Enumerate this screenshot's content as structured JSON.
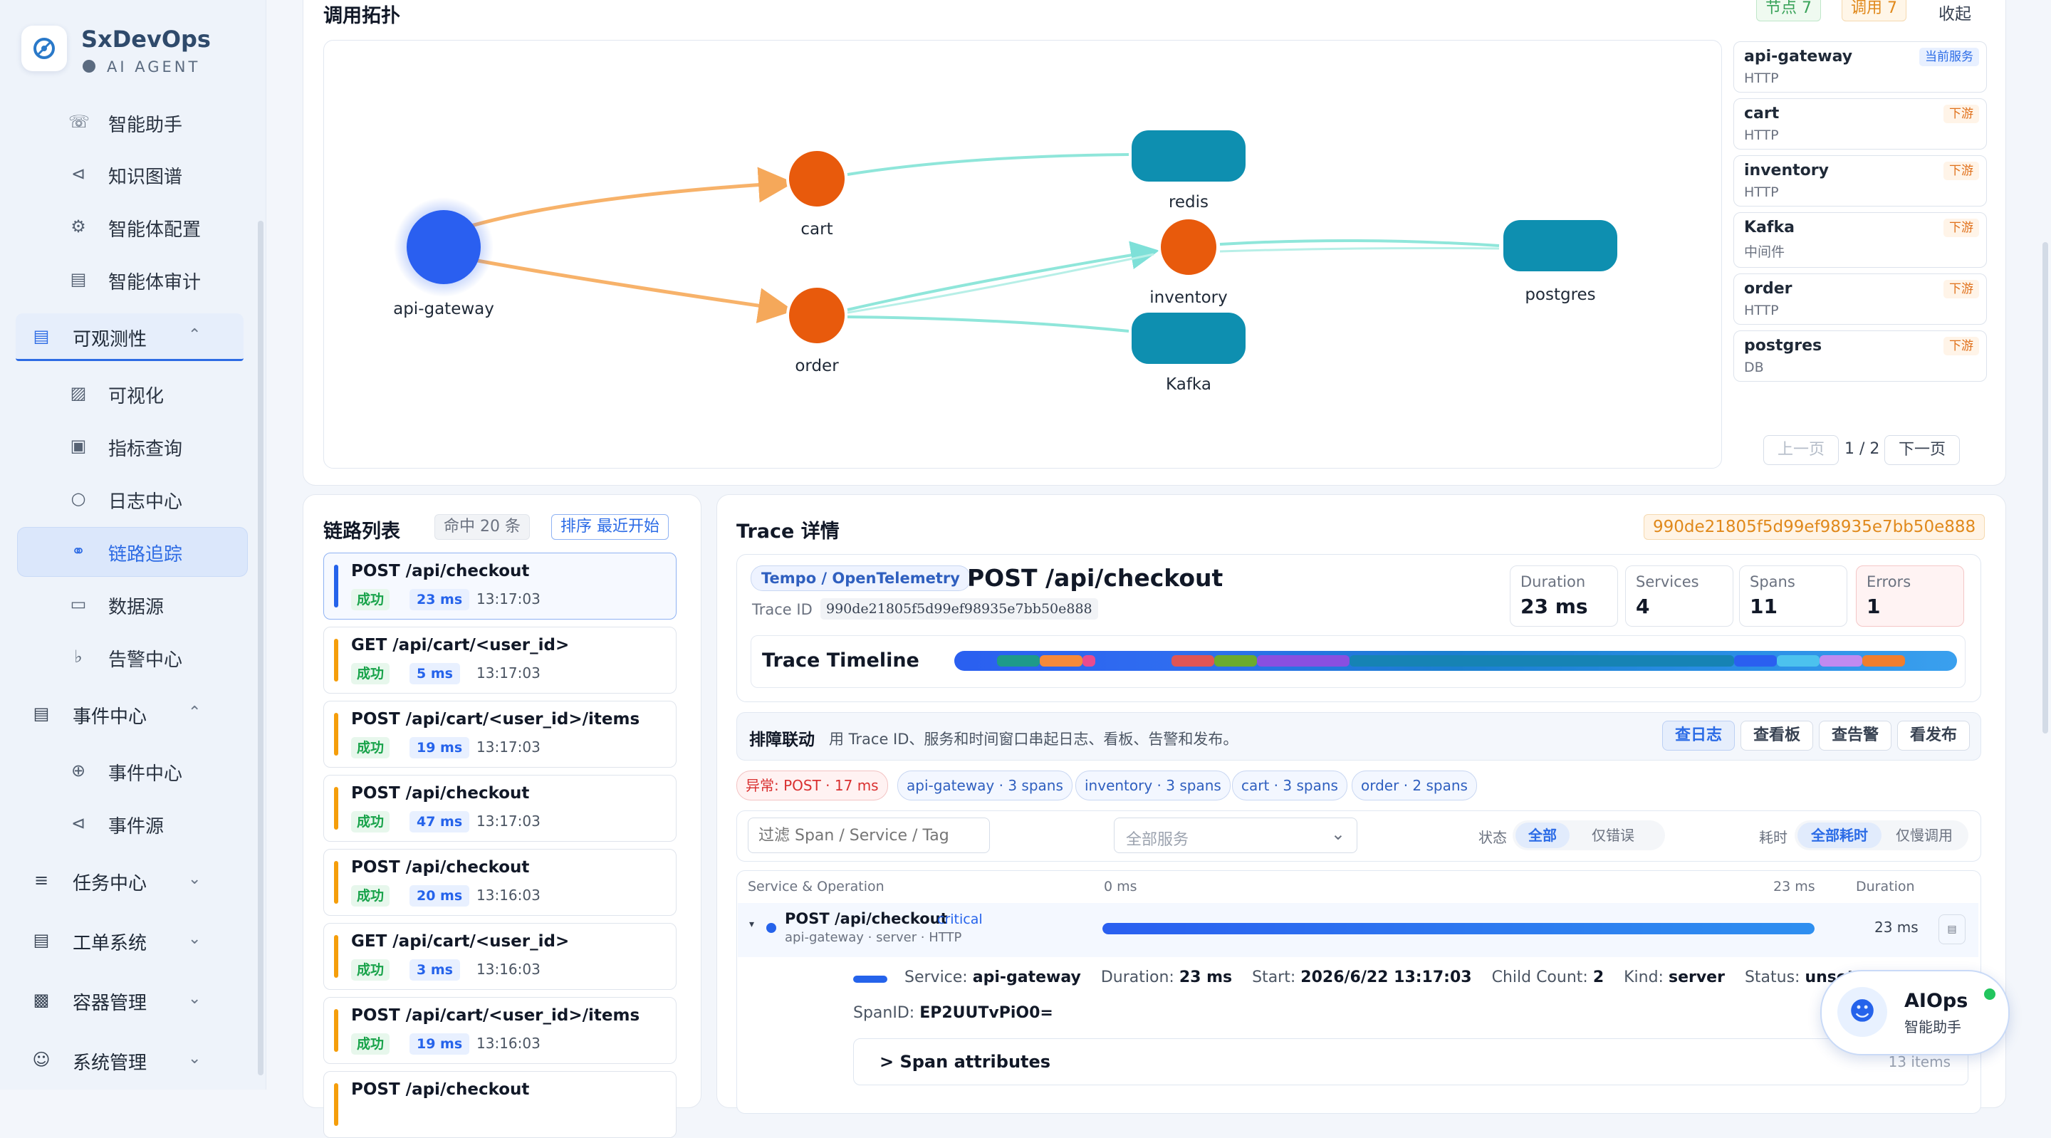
{
  "brand": {
    "title": "SxDevOps",
    "subtitle": "AI AGENT"
  },
  "sidebar": {
    "sub1": [
      {
        "label": "智能助手",
        "icon": "headset-icon"
      },
      {
        "label": "知识图谱",
        "icon": "share-icon"
      },
      {
        "label": "智能体配置",
        "icon": "gear-icon"
      },
      {
        "label": "智能体审计",
        "icon": "document-icon"
      }
    ],
    "group_observability": "可观测性",
    "sub2": [
      {
        "label": "可视化",
        "icon": "chart-icon"
      },
      {
        "label": "指标查询",
        "icon": "monitor-icon"
      },
      {
        "label": "日志中心",
        "icon": "search-icon"
      },
      {
        "label": "链路追踪",
        "icon": "trace-icon"
      },
      {
        "label": "数据源",
        "icon": "screen-icon"
      },
      {
        "label": "告警中心",
        "icon": "bell-icon"
      }
    ],
    "group_events": "事件中心",
    "sub3": [
      {
        "label": "事件中心",
        "icon": "crosshair-icon"
      },
      {
        "label": "事件源",
        "icon": "share-icon"
      }
    ],
    "groups": [
      {
        "label": "任务中心",
        "icon": "sliders-icon"
      },
      {
        "label": "工单系统",
        "icon": "document-icon"
      },
      {
        "label": "容器管理",
        "icon": "box-icon"
      },
      {
        "label": "系统管理",
        "icon": "user-icon"
      }
    ]
  },
  "topology": {
    "title": "调用拓扑",
    "node_chip": "节点 7",
    "call_chip": "调用 7",
    "collapse": "收起",
    "nodes": {
      "api_gateway": "api-gateway",
      "cart": "cart",
      "order": "order",
      "redis": "redis",
      "inventory": "inventory",
      "kafka": "Kafka",
      "postgres": "postgres"
    },
    "services": [
      {
        "name": "api-gateway",
        "type": "HTTP",
        "tag": "当前服务"
      },
      {
        "name": "cart",
        "type": "HTTP",
        "tag": "下游"
      },
      {
        "name": "inventory",
        "type": "HTTP",
        "tag": "下游"
      },
      {
        "name": "Kafka",
        "type": "中间件",
        "tag": "下游"
      },
      {
        "name": "order",
        "type": "HTTP",
        "tag": "下游"
      },
      {
        "name": "postgres",
        "type": "DB",
        "tag": "下游"
      }
    ],
    "prev": "上一页",
    "page": "1 / 2",
    "next": "下一页"
  },
  "trace_list": {
    "title": "链路列表",
    "count_chip": "命中 20 条",
    "sort_chip": "排序 最近开始",
    "items": [
      {
        "title": "POST /api/checkout",
        "status": "成功",
        "duration": "23 ms",
        "time": "13:17:03"
      },
      {
        "title": "GET /api/cart/<user_id>",
        "status": "成功",
        "duration": "5 ms",
        "time": "13:17:03"
      },
      {
        "title": "POST /api/cart/<user_id>/items",
        "status": "成功",
        "duration": "19 ms",
        "time": "13:17:03"
      },
      {
        "title": "POST /api/checkout",
        "status": "成功",
        "duration": "47 ms",
        "time": "13:17:03"
      },
      {
        "title": "POST /api/checkout",
        "status": "成功",
        "duration": "20 ms",
        "time": "13:16:03"
      },
      {
        "title": "GET /api/cart/<user_id>",
        "status": "成功",
        "duration": "3 ms",
        "time": "13:16:03"
      },
      {
        "title": "POST /api/cart/<user_id>/items",
        "status": "成功",
        "duration": "19 ms",
        "time": "13:16:03"
      },
      {
        "title": "POST /api/checkout",
        "status": "",
        "duration": "",
        "time": ""
      }
    ]
  },
  "detail": {
    "title": "Trace 详情",
    "trace_id_chip": "990de21805f5d99ef98935e7bb50e888",
    "source_tag": "Tempo / OpenTelemetry",
    "operation": "POST /api/checkout",
    "trace_id_label": "Trace ID",
    "trace_id": "990de21805f5d99ef98935e7bb50e888",
    "metrics": [
      {
        "k": "Duration",
        "v": "23 ms"
      },
      {
        "k": "Services",
        "v": "4"
      },
      {
        "k": "Spans",
        "v": "11"
      },
      {
        "k": "Errors",
        "v": "1"
      }
    ],
    "timeline_label": "Trace Timeline",
    "linkage_title": "排障联动",
    "linkage_desc": "用 Trace ID、服务和时间窗口串起日志、看板、告警和发布。",
    "linkage_buttons": [
      "查日志",
      "查看板",
      "查告警",
      "看发布"
    ],
    "pills": [
      "异常: POST · 17 ms",
      "api-gateway · 3 spans",
      "inventory · 3 spans",
      "cart · 3 spans",
      "order · 2 spans"
    ],
    "filter_placeholder": "过滤 Span / Service / Tag",
    "service_select": "全部服务",
    "status_label": "状态",
    "status_all": "全部",
    "status_err": "仅错误",
    "cost_label": "耗时",
    "cost_all": "全部耗时",
    "cost_slow": "仅慢调用",
    "table_headers": [
      "Service & Operation",
      "0 ms",
      "23 ms",
      "Duration"
    ],
    "span": {
      "op": "POST /api/checkout",
      "badge": "critical",
      "sub": "api-gateway · server · HTTP",
      "duration": "23 ms",
      "progress": 1.0
    },
    "span_detail": {
      "service_k": "Service:",
      "service_v": "api-gateway",
      "duration_k": "Duration:",
      "duration_v": "23 ms",
      "start_k": "Start:",
      "start_v": "2026/6/22 13:17:03",
      "child_k": "Child Count:",
      "child_v": "2",
      "kind_k": "Kind:",
      "kind_v": "server",
      "status_k": "Status:",
      "status_v": "unset",
      "spanid_k": "SpanID:",
      "spanid_v": "EP2UUTvPiO0=",
      "attrs_label": "Span attributes",
      "attrs_count": "13 items"
    }
  },
  "aiops": {
    "title": "AIOps",
    "subtitle": "智能助手"
  },
  "colors": {
    "accent": "#2563eb",
    "orange": "#e85a0c",
    "teal": "#0e8fb0"
  }
}
